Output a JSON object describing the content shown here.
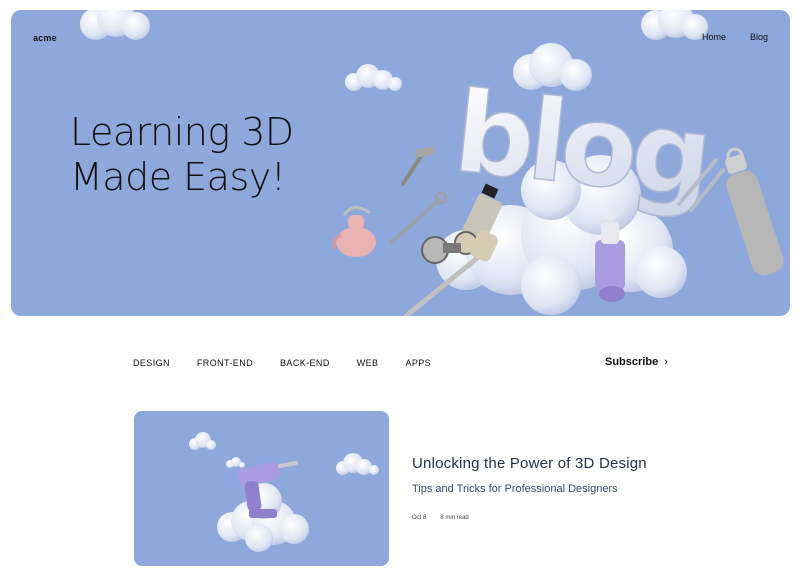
{
  "header": {
    "brand": "acme",
    "nav": [
      "Home",
      "Blog"
    ]
  },
  "hero": {
    "title_line1": "Learning 3D",
    "title_line2": "Made Easy!",
    "art_word": "blog"
  },
  "categories": [
    "DESIGN",
    "FRONT-END",
    "BACK-END",
    "WEB",
    "APPS"
  ],
  "subscribe": {
    "label": "Subscribe",
    "icon": "chevron-right-icon"
  },
  "post": {
    "title": "Unlocking the Power of 3D Design",
    "subtitle": "Tips and Tricks for Professional Designers",
    "date": "Oct 8",
    "read_time": "8 min read"
  },
  "colors": {
    "hero_bg": "#8ea8dc",
    "text": "#111111",
    "post_title": "#27314a"
  }
}
